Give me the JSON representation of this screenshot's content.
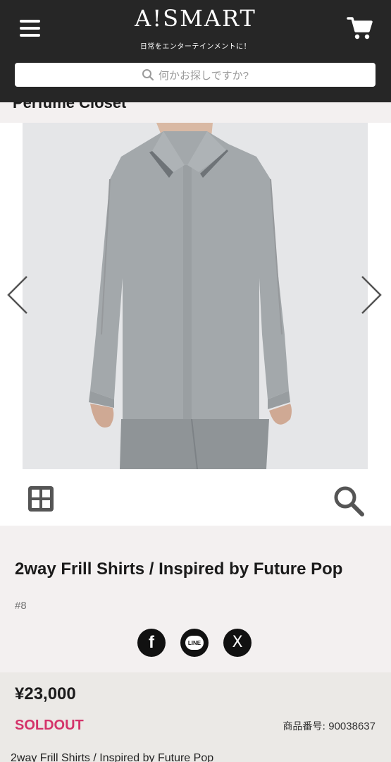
{
  "header": {
    "logo": "A!SMART",
    "tagline": "日常をエンターテインメントに！",
    "search_placeholder": "何かお探しですか?"
  },
  "product": {
    "cut_title": "Perfume Closet",
    "title": "2way Frill Shirts / Inspired by Future Pop",
    "item_number": "#8",
    "price": "¥23,000",
    "status": "SOLDOUT",
    "sku_label": "商品番号:",
    "sku_value": "90038637",
    "description_preview": "2way Frill Shirts / Inspired by Future Pop"
  },
  "social": {
    "facebook": "f",
    "line": "LINE",
    "x": "X"
  },
  "colors": {
    "header_bg": "#262626",
    "soldout": "#d4336a",
    "info_bg": "#f3f0f0",
    "price_bg": "#ebe9e6"
  }
}
